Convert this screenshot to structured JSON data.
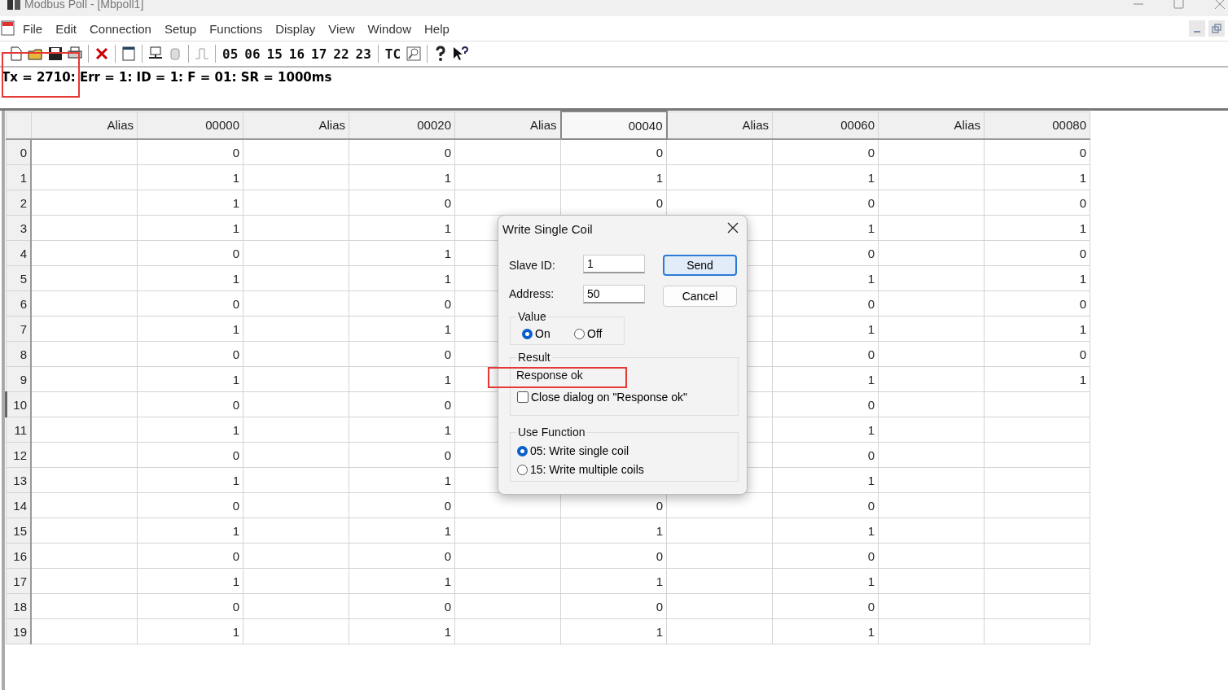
{
  "window": {
    "title": "Modbus Poll - [Mbpoll1]"
  },
  "menu": [
    "File",
    "Edit",
    "Connection",
    "Setup",
    "Functions",
    "Display",
    "View",
    "Window",
    "Help"
  ],
  "toolbar": {
    "function_buttons": [
      "05",
      "06",
      "15",
      "16",
      "17",
      "22",
      "23"
    ],
    "tc_button": "TC"
  },
  "status": "Tx = 2710: Err = 1: ID = 1: F = 01: SR = 1000ms",
  "table": {
    "columns": [
      {
        "alias": "Alias",
        "label": "00000",
        "selected": false
      },
      {
        "alias": "Alias",
        "label": "00020",
        "selected": false
      },
      {
        "alias": "Alias",
        "label": "00040",
        "selected": true
      },
      {
        "alias": "Alias",
        "label": "00060",
        "selected": false
      },
      {
        "alias": "Alias",
        "label": "00080",
        "selected": false
      }
    ],
    "rows": [
      {
        "label": "0",
        "selected": false,
        "values": {
          "column_1": "0",
          "column_2": "0",
          "column_3": "0",
          "column_4": "0",
          "column_5": "0"
        }
      },
      {
        "label": "1",
        "selected": false,
        "values": {
          "column_1": "1",
          "column_2": "1",
          "column_3": "1",
          "column_4": "1",
          "column_5": "1"
        }
      },
      {
        "label": "2",
        "selected": false,
        "values": {
          "column_1": "1",
          "column_2": "0",
          "column_3": "0",
          "column_4": "0",
          "column_5": "0"
        }
      },
      {
        "label": "3",
        "selected": false,
        "values": {
          "column_1": "1",
          "column_2": "1",
          "column_4": "1",
          "column_5": "1"
        }
      },
      {
        "label": "4",
        "selected": false,
        "values": {
          "column_1": "0",
          "column_2": "1",
          "column_4": "0",
          "column_5": "0"
        }
      },
      {
        "label": "5",
        "selected": false,
        "values": {
          "column_1": "1",
          "column_2": "1",
          "column_4": "1",
          "column_5": "1"
        }
      },
      {
        "label": "6",
        "selected": false,
        "values": {
          "column_1": "0",
          "column_2": "0",
          "column_4": "0",
          "column_5": "0"
        }
      },
      {
        "label": "7",
        "selected": false,
        "values": {
          "column_1": "1",
          "column_2": "1",
          "column_4": "1",
          "column_5": "1"
        }
      },
      {
        "label": "8",
        "selected": false,
        "values": {
          "column_1": "0",
          "column_2": "0",
          "column_4": "0",
          "column_5": "0"
        }
      },
      {
        "label": "9",
        "selected": false,
        "values": {
          "column_1": "1",
          "column_2": "1",
          "column_4": "1",
          "column_5": "1"
        }
      },
      {
        "label": "10",
        "selected": true,
        "values": {
          "column_1": "0",
          "column_2": "0",
          "column_4": "0"
        }
      },
      {
        "label": "11",
        "selected": false,
        "values": {
          "column_1": "1",
          "column_2": "1",
          "column_4": "1"
        }
      },
      {
        "label": "12",
        "selected": false,
        "values": {
          "column_1": "0",
          "column_2": "0",
          "column_4": "0"
        }
      },
      {
        "label": "13",
        "selected": false,
        "values": {
          "column_1": "1",
          "column_2": "1",
          "column_4": "1"
        }
      },
      {
        "label": "14",
        "selected": false,
        "values": {
          "column_1": "0",
          "column_2": "0",
          "column_3": "0",
          "column_4": "0"
        }
      },
      {
        "label": "15",
        "selected": false,
        "values": {
          "column_1": "1",
          "column_2": "1",
          "column_3": "1",
          "column_4": "1"
        }
      },
      {
        "label": "16",
        "selected": false,
        "values": {
          "column_1": "0",
          "column_2": "0",
          "column_3": "0",
          "column_4": "0"
        }
      },
      {
        "label": "17",
        "selected": false,
        "values": {
          "column_1": "1",
          "column_2": "1",
          "column_3": "1",
          "column_4": "1"
        }
      },
      {
        "label": "18",
        "selected": false,
        "values": {
          "column_1": "0",
          "column_2": "0",
          "column_3": "0",
          "column_4": "0"
        }
      },
      {
        "label": "19",
        "selected": false,
        "values": {
          "column_1": "1",
          "column_2": "1",
          "column_3": "1",
          "column_4": "1"
        }
      }
    ]
  },
  "dialog": {
    "title": "Write Single Coil",
    "slave_id": {
      "label": "Slave ID:",
      "value": "1"
    },
    "address": {
      "label": "Address:",
      "value": "50"
    },
    "buttons": [
      {
        "label": "Send",
        "default": true
      },
      {
        "label": "Cancel",
        "default": false
      }
    ],
    "value_group": {
      "title": "Value",
      "options": [
        {
          "label": "On",
          "selected": true
        },
        {
          "label": "Off",
          "selected": false
        }
      ]
    },
    "result": {
      "title": "Result",
      "text": "Response ok",
      "checkbox": {
        "label": "Close dialog on \"Response ok\"",
        "checked": false
      }
    },
    "function_group": {
      "title": "Use Function",
      "options": [
        {
          "label": "05: Write single coil",
          "selected": true
        },
        {
          "label": "15: Write multiple coils",
          "selected": false
        }
      ]
    }
  }
}
